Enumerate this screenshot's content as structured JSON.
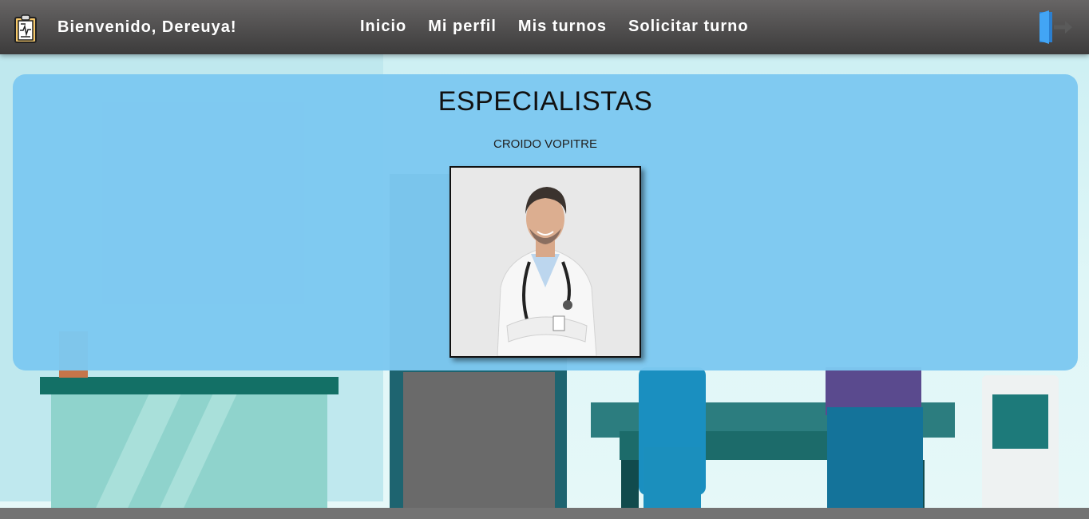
{
  "navbar": {
    "logo_icon": "clipboard-medical-icon",
    "welcome": "Bienvenido, Dereuya!",
    "links": [
      {
        "label": "Inicio"
      },
      {
        "label": "Mi perfil"
      },
      {
        "label": "Mis turnos"
      },
      {
        "label": "Solicitar turno"
      }
    ],
    "logout_icon": "logout-door-icon"
  },
  "specialists": {
    "title": "ESPECIALISTAS",
    "doctors": [
      {
        "name": "CROIDO VOPITRE",
        "photo_icon": "doctor-photo"
      }
    ]
  },
  "colors": {
    "navbar": "#4f4e4e",
    "panel": "#7dc8f1",
    "logout_accent": "#42a5f5"
  }
}
